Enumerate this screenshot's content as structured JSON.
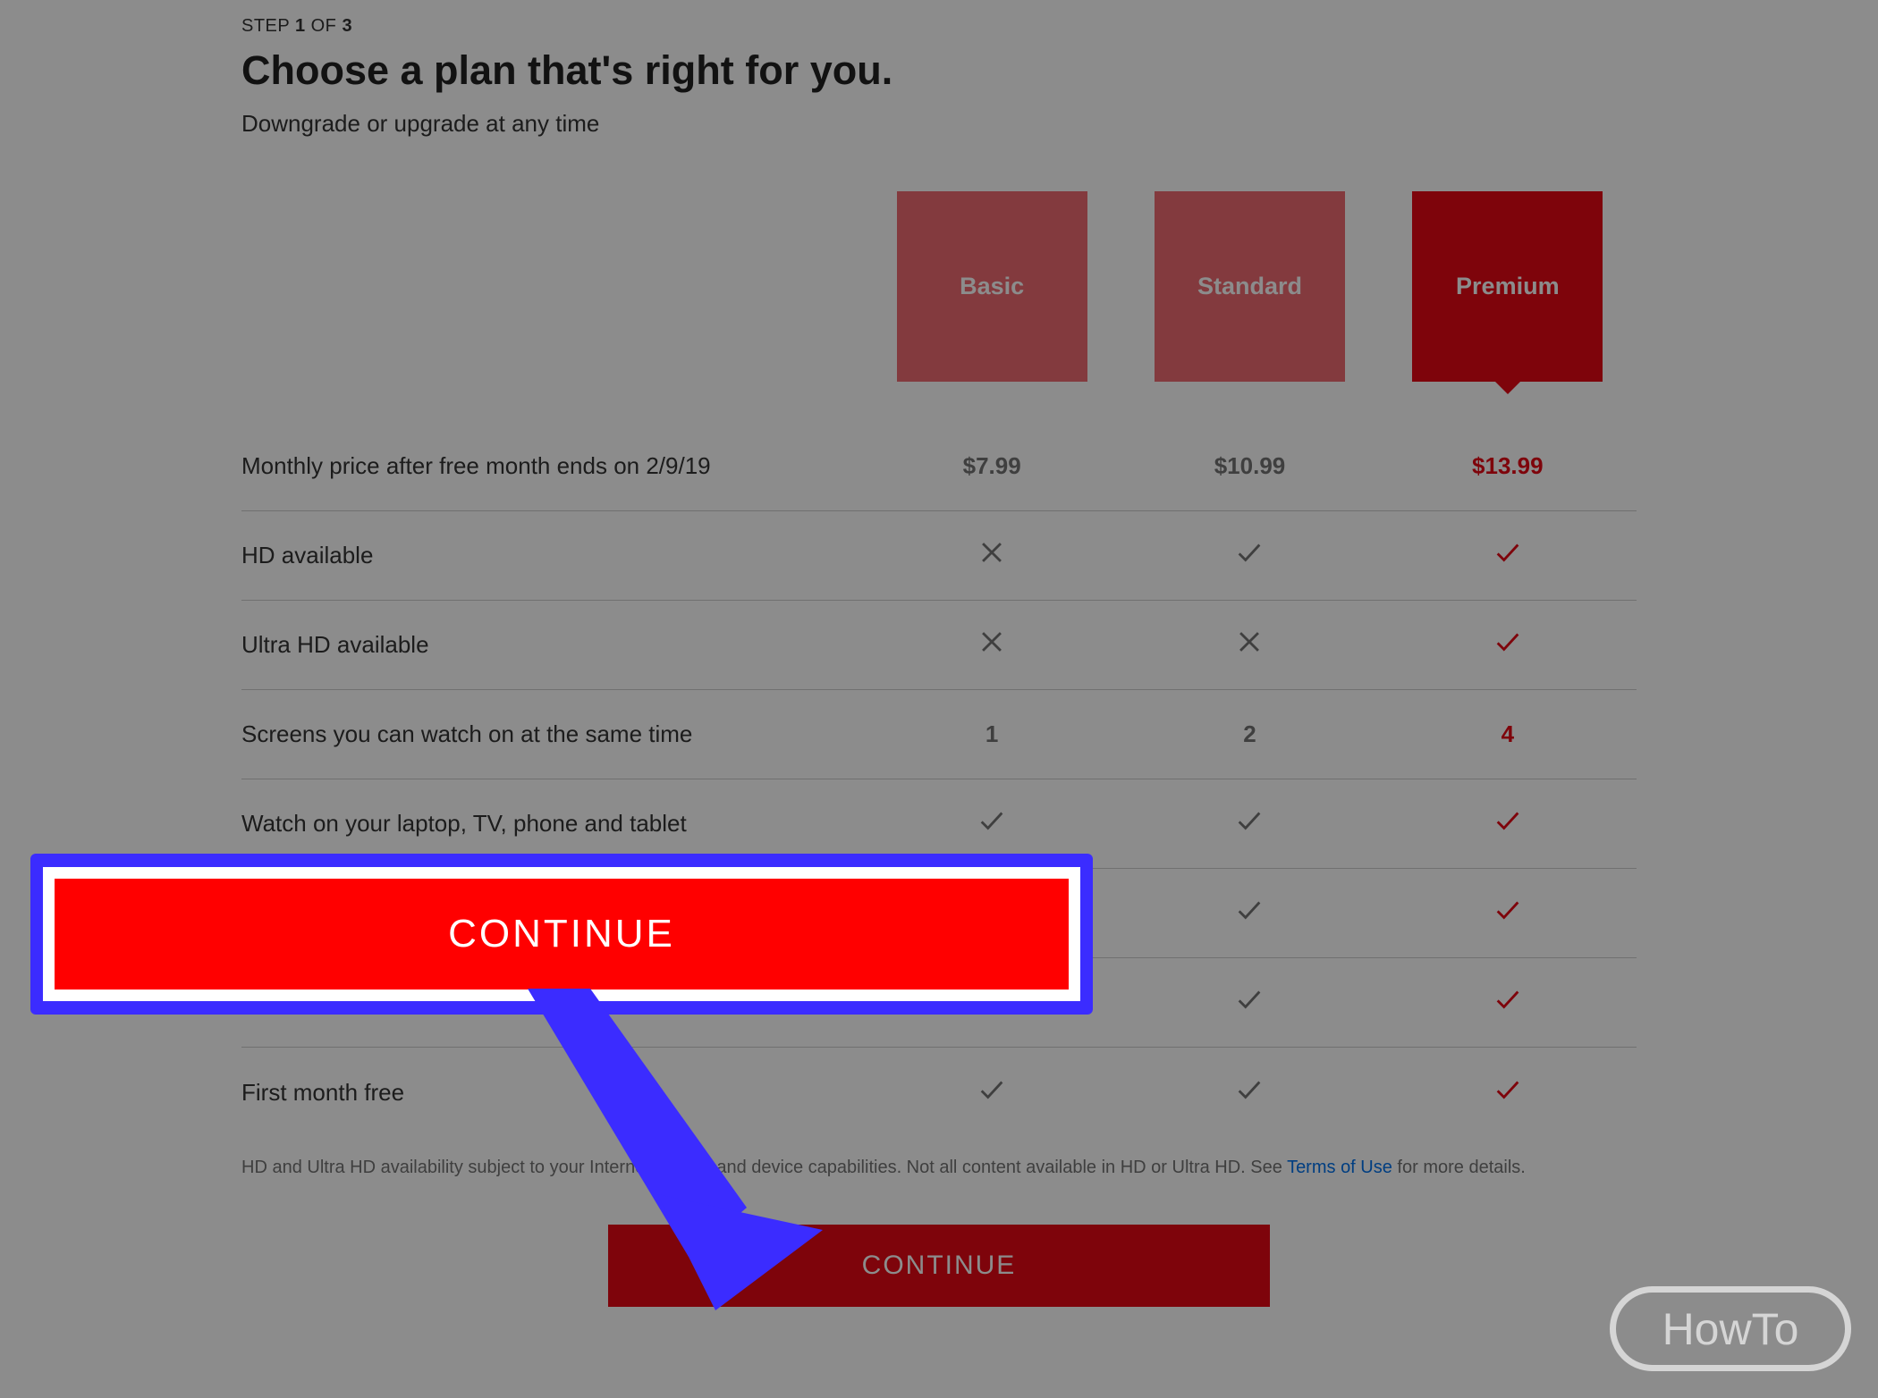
{
  "step": {
    "prefix": "STEP ",
    "current": "1",
    "middle": " OF ",
    "total": "3"
  },
  "title": "Choose a plan that's right for you.",
  "subtitle": "Downgrade or upgrade at any time",
  "plans": {
    "basic": "Basic",
    "standard": "Standard",
    "premium": "Premium"
  },
  "rows": {
    "price": {
      "label": "Monthly price after free month ends on 2/9/19",
      "basic": "$7.99",
      "standard": "$10.99",
      "premium": "$13.99"
    },
    "hd": {
      "label": "HD available"
    },
    "uhd": {
      "label": "Ultra HD available"
    },
    "screens": {
      "label": "Screens you can watch on at the same time",
      "basic": "1",
      "standard": "2",
      "premium": "4"
    },
    "devices": {
      "label": "Watch on your laptop, TV, phone and tablet"
    },
    "first_month": {
      "label": "First month free"
    }
  },
  "disclaimer": {
    "text1": "HD and Ultra HD availability subject to your Internet service and device capabilities. Not all content available in HD or Ultra HD. See ",
    "link": "Terms of Use",
    "text2": " for more details."
  },
  "continue_label": "CONTINUE",
  "annotation_continue": "CONTINUE",
  "howto": "HowTo"
}
